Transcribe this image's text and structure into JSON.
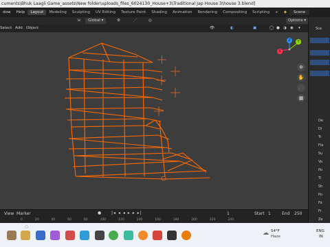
{
  "window": {
    "title": "cuments\\Bhuk Laagli Game_assets\\New folder\\uploads_files_6024130_House+3\\Traditional Jap House 3\\house 3.blend]"
  },
  "topbar": {
    "menus": [
      "dow",
      "Help"
    ],
    "workspaces": [
      "Layout",
      "Modeling",
      "Sculpting",
      "UV Editing",
      "Texture Paint",
      "Shading",
      "Animation",
      "Rendering",
      "Compositing",
      "Scripting"
    ],
    "active_workspace": "Layout",
    "add_tab": "+",
    "scene_label": "Scene"
  },
  "viewport_header": {
    "orientation": "Global",
    "options_label": "Options"
  },
  "viewport_menu": {
    "items": [
      "Select",
      "Add",
      "Object"
    ]
  },
  "timeline": {
    "menu_items": [
      "View",
      "Marker"
    ],
    "current_frame": "1",
    "start_label": "Start",
    "start_value": "1",
    "end_label": "End",
    "end_value": "250",
    "ruler": [
      "0",
      "20",
      "40",
      "60",
      "80",
      "100",
      "120",
      "140",
      "160",
      "180",
      "200",
      "220",
      "240"
    ]
  },
  "gizmo": {
    "y_label": "Y",
    "z_label": "Z",
    "x_label": "X"
  },
  "taskbar": {
    "weather_temp": "54°F",
    "weather_text": "Haze",
    "lang_top": "ENG",
    "lang_bottom": "IN"
  },
  "right_panel": {
    "letters": [
      "Sce",
      "De",
      "Di",
      "Tr",
      "Fla",
      "Su",
      "Vo",
      "Po",
      "Ti",
      "Sh",
      "Po",
      "Fir",
      "Fr",
      "Ze"
    ]
  },
  "colors": {
    "wire": "#ff6a00",
    "viewport_bg": "#3d3d3d",
    "axis_x": "#ff3352",
    "axis_y": "#8bdc00",
    "axis_z": "#2890ff"
  }
}
